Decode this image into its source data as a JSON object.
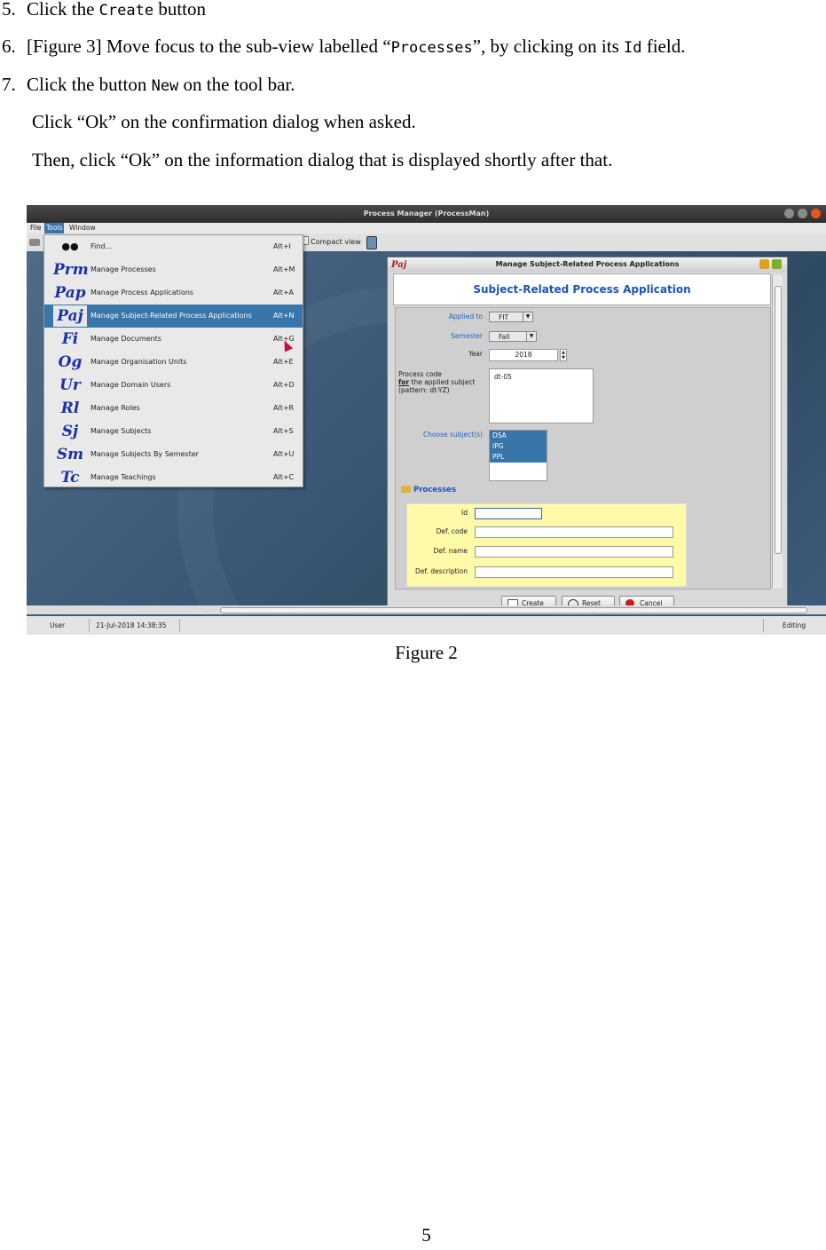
{
  "steps": [
    {
      "num": "5.",
      "before": "Click the ",
      "code": "Create",
      "after": " button"
    },
    {
      "num": "6.",
      "before": "[Figure 3] Move focus to the sub-view labelled “",
      "code": "Processes",
      "middle": "”, by clicking on its ",
      "code2": "Id",
      "after": " field."
    },
    {
      "num": "7.",
      "before": "Click the button ",
      "code": "New",
      "after": " on the tool bar."
    }
  ],
  "sub_lines": [
    "Click “Ok” on the confirmation dialog when asked.",
    "Then, click “Ok” on the information dialog that is displayed shortly after that."
  ],
  "screenshot": {
    "window_title": "Process Manager (ProcessMan)",
    "menubar": [
      "File",
      "Tools",
      "Window"
    ],
    "compact_view": "Compact view",
    "menu_items": [
      {
        "icon": "",
        "label": "Find...",
        "accel": "Alt+I"
      },
      {
        "icon": "Prm",
        "label": "Manage Processes",
        "accel": "Alt+M"
      },
      {
        "icon": "Pap",
        "label": "Manage Process Applications",
        "accel": "Alt+A"
      },
      {
        "icon": "Paj",
        "label": "Manage Subject-Related Process Applications",
        "accel": "Alt+N"
      },
      {
        "icon": "Fi",
        "label": "Manage Documents",
        "accel": "Alt+G"
      },
      {
        "icon": "Og",
        "label": "Manage Organisation Units",
        "accel": "Alt+E"
      },
      {
        "icon": "Ur",
        "label": "Manage Domain Users",
        "accel": "Alt+D"
      },
      {
        "icon": "Rl",
        "label": "Manage Roles",
        "accel": "Alt+R"
      },
      {
        "icon": "Sj",
        "label": "Manage Subjects",
        "accel": "Alt+S"
      },
      {
        "icon": "Sm",
        "label": "Manage Subjects By Semester",
        "accel": "Alt+U"
      },
      {
        "icon": "Tc",
        "label": "Manage Teachings",
        "accel": "Alt+C"
      }
    ],
    "dialog": {
      "title": "Manage Subject-Related Process Applications",
      "icon_text": "Paj",
      "heading": "Subject-Related Process Application",
      "applied_to_label": "Applied to",
      "applied_to_value": "FIT",
      "semester_label": "Semester",
      "semester_value": "Fall",
      "year_label": "Year",
      "year_value": "2018",
      "process_code_line1": "Process code",
      "process_code_for": "for",
      "process_code_line2": " the applied subject",
      "process_code_line3": "(pattern: dt-YZ)",
      "process_code_value": "dt-05",
      "choose_subjects_label": "Choose subject(s)",
      "subjects": [
        "DSA",
        "IPG",
        "PPL"
      ],
      "processes_label": "Processes",
      "id_label": "Id",
      "def_code_label": "Def. code",
      "def_name_label": "Def. name",
      "def_description_label": "Def. description",
      "create_label": "Create",
      "reset_label": "Reset",
      "cancel_label": "Cancel"
    },
    "status": {
      "user": "User",
      "datetime": "21-Jul-2018 14:38:35",
      "mode": "Editing"
    }
  },
  "caption": "Figure 2",
  "page_number": "5"
}
